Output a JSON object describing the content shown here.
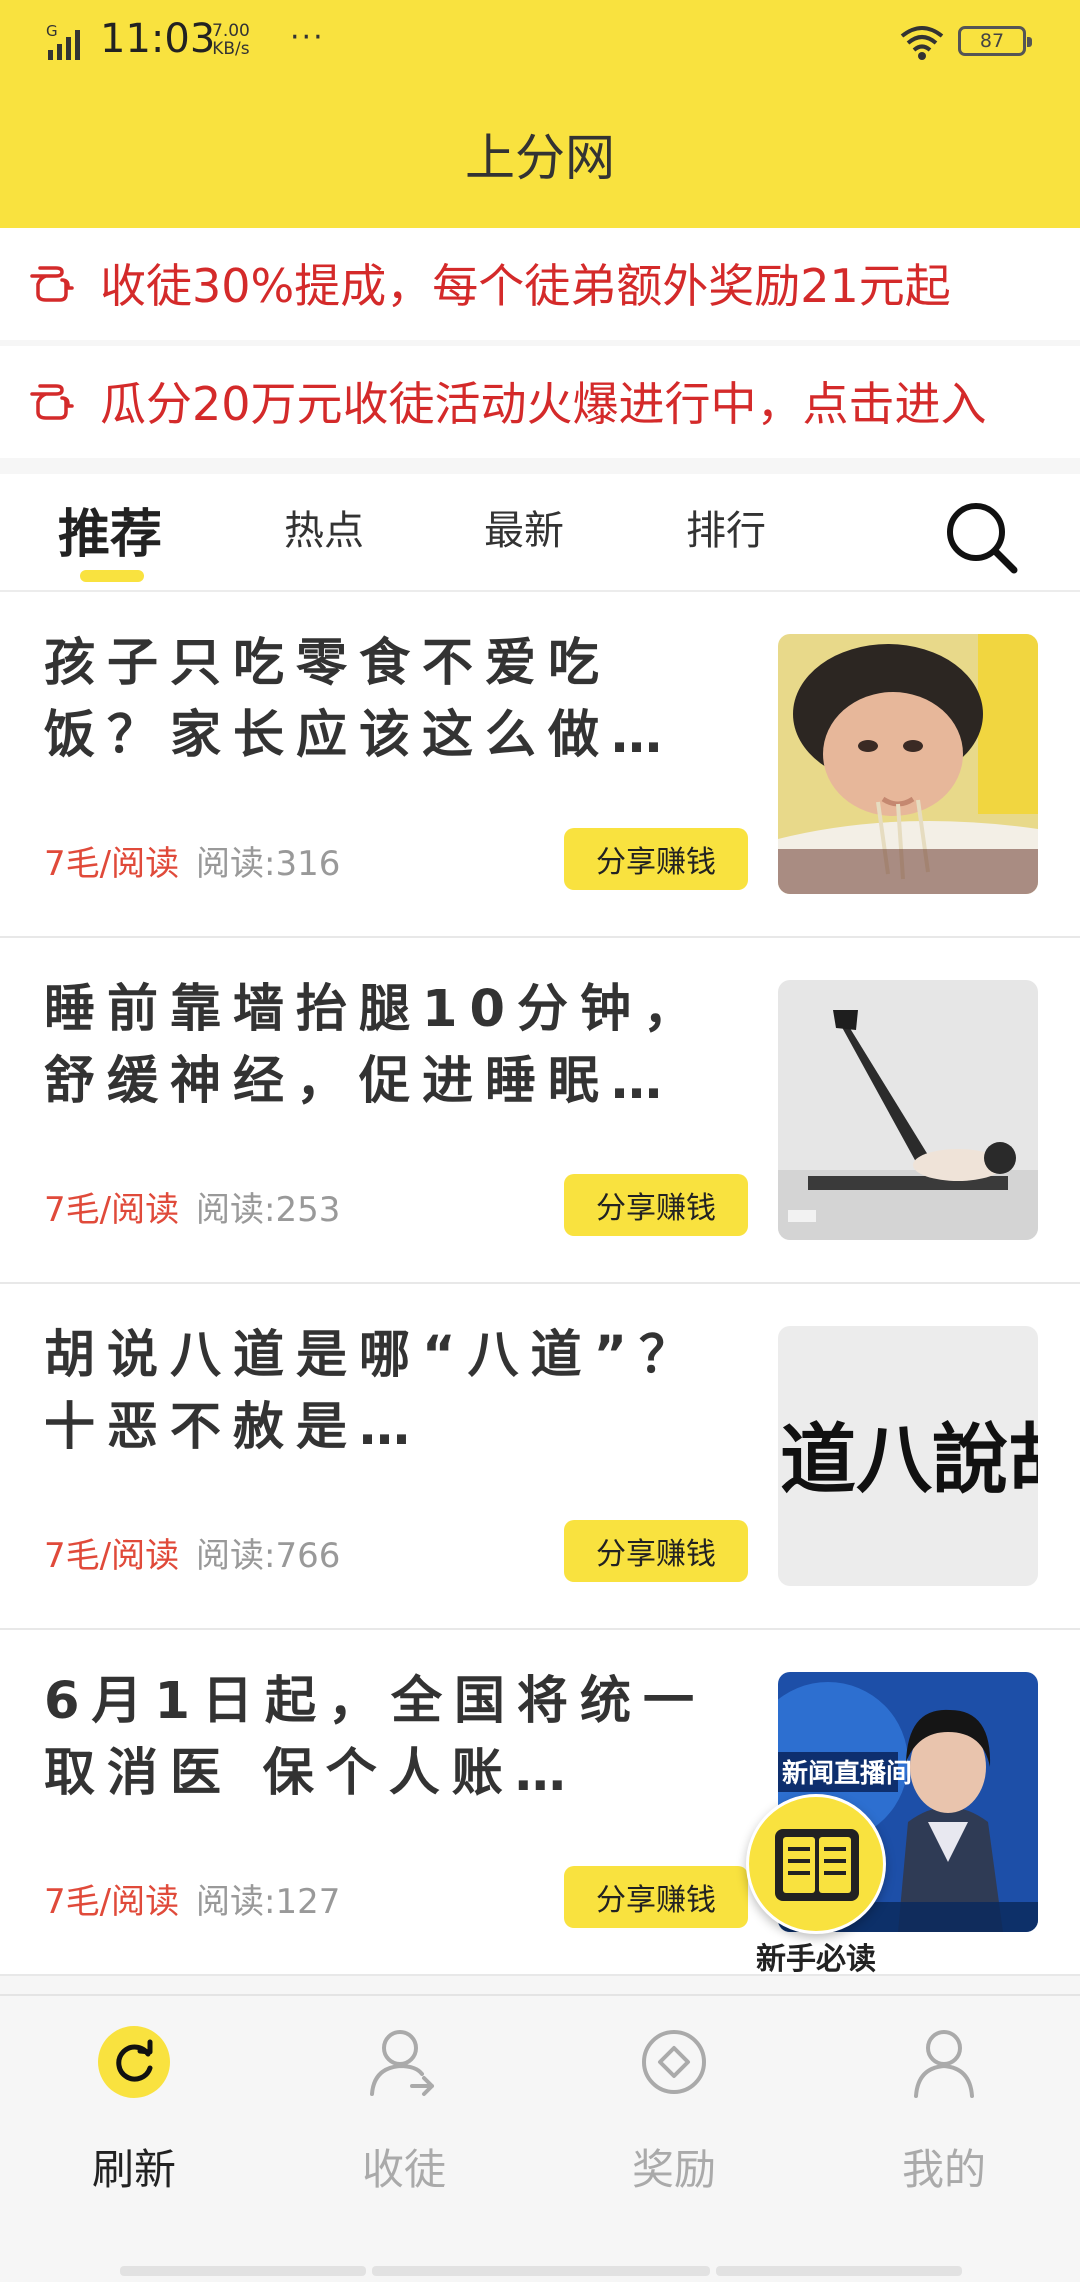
{
  "status_bar": {
    "time": "11:03",
    "network_type": "G",
    "speed_value": "7.00",
    "speed_unit": "KB/s",
    "more": "···",
    "battery": "87"
  },
  "app": {
    "title": "上分网"
  },
  "notices": [
    {
      "text": "收徒30%提成，每个徒弟额外奖励21元起",
      "icon": "pointing-hand-icon"
    },
    {
      "text": "瓜分20万元收徒活动火爆进行中，点击进入",
      "icon": "pointing-hand-icon"
    }
  ],
  "tabs": [
    {
      "label": "推荐",
      "active": true
    },
    {
      "label": "热点",
      "active": false
    },
    {
      "label": "最新",
      "active": false
    },
    {
      "label": "排行",
      "active": false
    }
  ],
  "articles": [
    {
      "title": "孩子只吃零食不爱吃饭？家长应该这么做…",
      "price": "7毛/阅读",
      "reads": "阅读:316",
      "share_label": "分享赚钱",
      "thumb": "child-eating-photo"
    },
    {
      "title": "睡前靠墙抬腿10分钟，舒缓神经，促进睡眠…",
      "price": "7毛/阅读",
      "reads": "阅读:253",
      "share_label": "分享赚钱",
      "thumb": "leg-raise-exercise-photo"
    },
    {
      "title": "胡说八道是哪“八道”？十恶不赦是…",
      "price": "7毛/阅读",
      "reads": "阅读:766",
      "share_label": "分享赚钱",
      "thumb": "calligraphy-photo",
      "thumb_text": "道八說胡"
    },
    {
      "title": "6月1日起，全国将统一取消医 保个人账…",
      "price": "7毛/阅读",
      "reads": "阅读:127",
      "share_label": "分享赚钱",
      "thumb": "news-broadcast-photo",
      "thumb_text": "新闻直播间"
    }
  ],
  "floating_guide": {
    "label": "新手必读",
    "icon": "book-icon"
  },
  "bottom_nav": [
    {
      "label": "刷新",
      "icon": "refresh-icon",
      "active": true
    },
    {
      "label": "收徒",
      "icon": "user-add-icon",
      "active": false
    },
    {
      "label": "奖励",
      "icon": "reward-icon",
      "active": false
    },
    {
      "label": "我的",
      "icon": "profile-icon",
      "active": false
    }
  ],
  "colors": {
    "brand_yellow": "#f9e23f",
    "notice_red": "#d42a2a",
    "price_red": "#e04a3a",
    "muted_gray": "#999999"
  }
}
